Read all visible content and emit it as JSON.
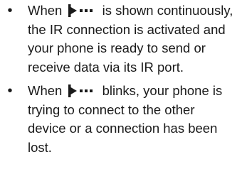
{
  "items": [
    {
      "bullet": "•",
      "icon": "ir-connection-icon",
      "pre": "When",
      "post": "is shown continuously, the IR connection is activated and your phone is ready to send or receive data via its IR port."
    },
    {
      "bullet": "•",
      "icon": "ir-connection-icon",
      "pre": "When",
      "post": "blinks, your phone is trying to connect to the other device or a connection has been lost."
    }
  ]
}
